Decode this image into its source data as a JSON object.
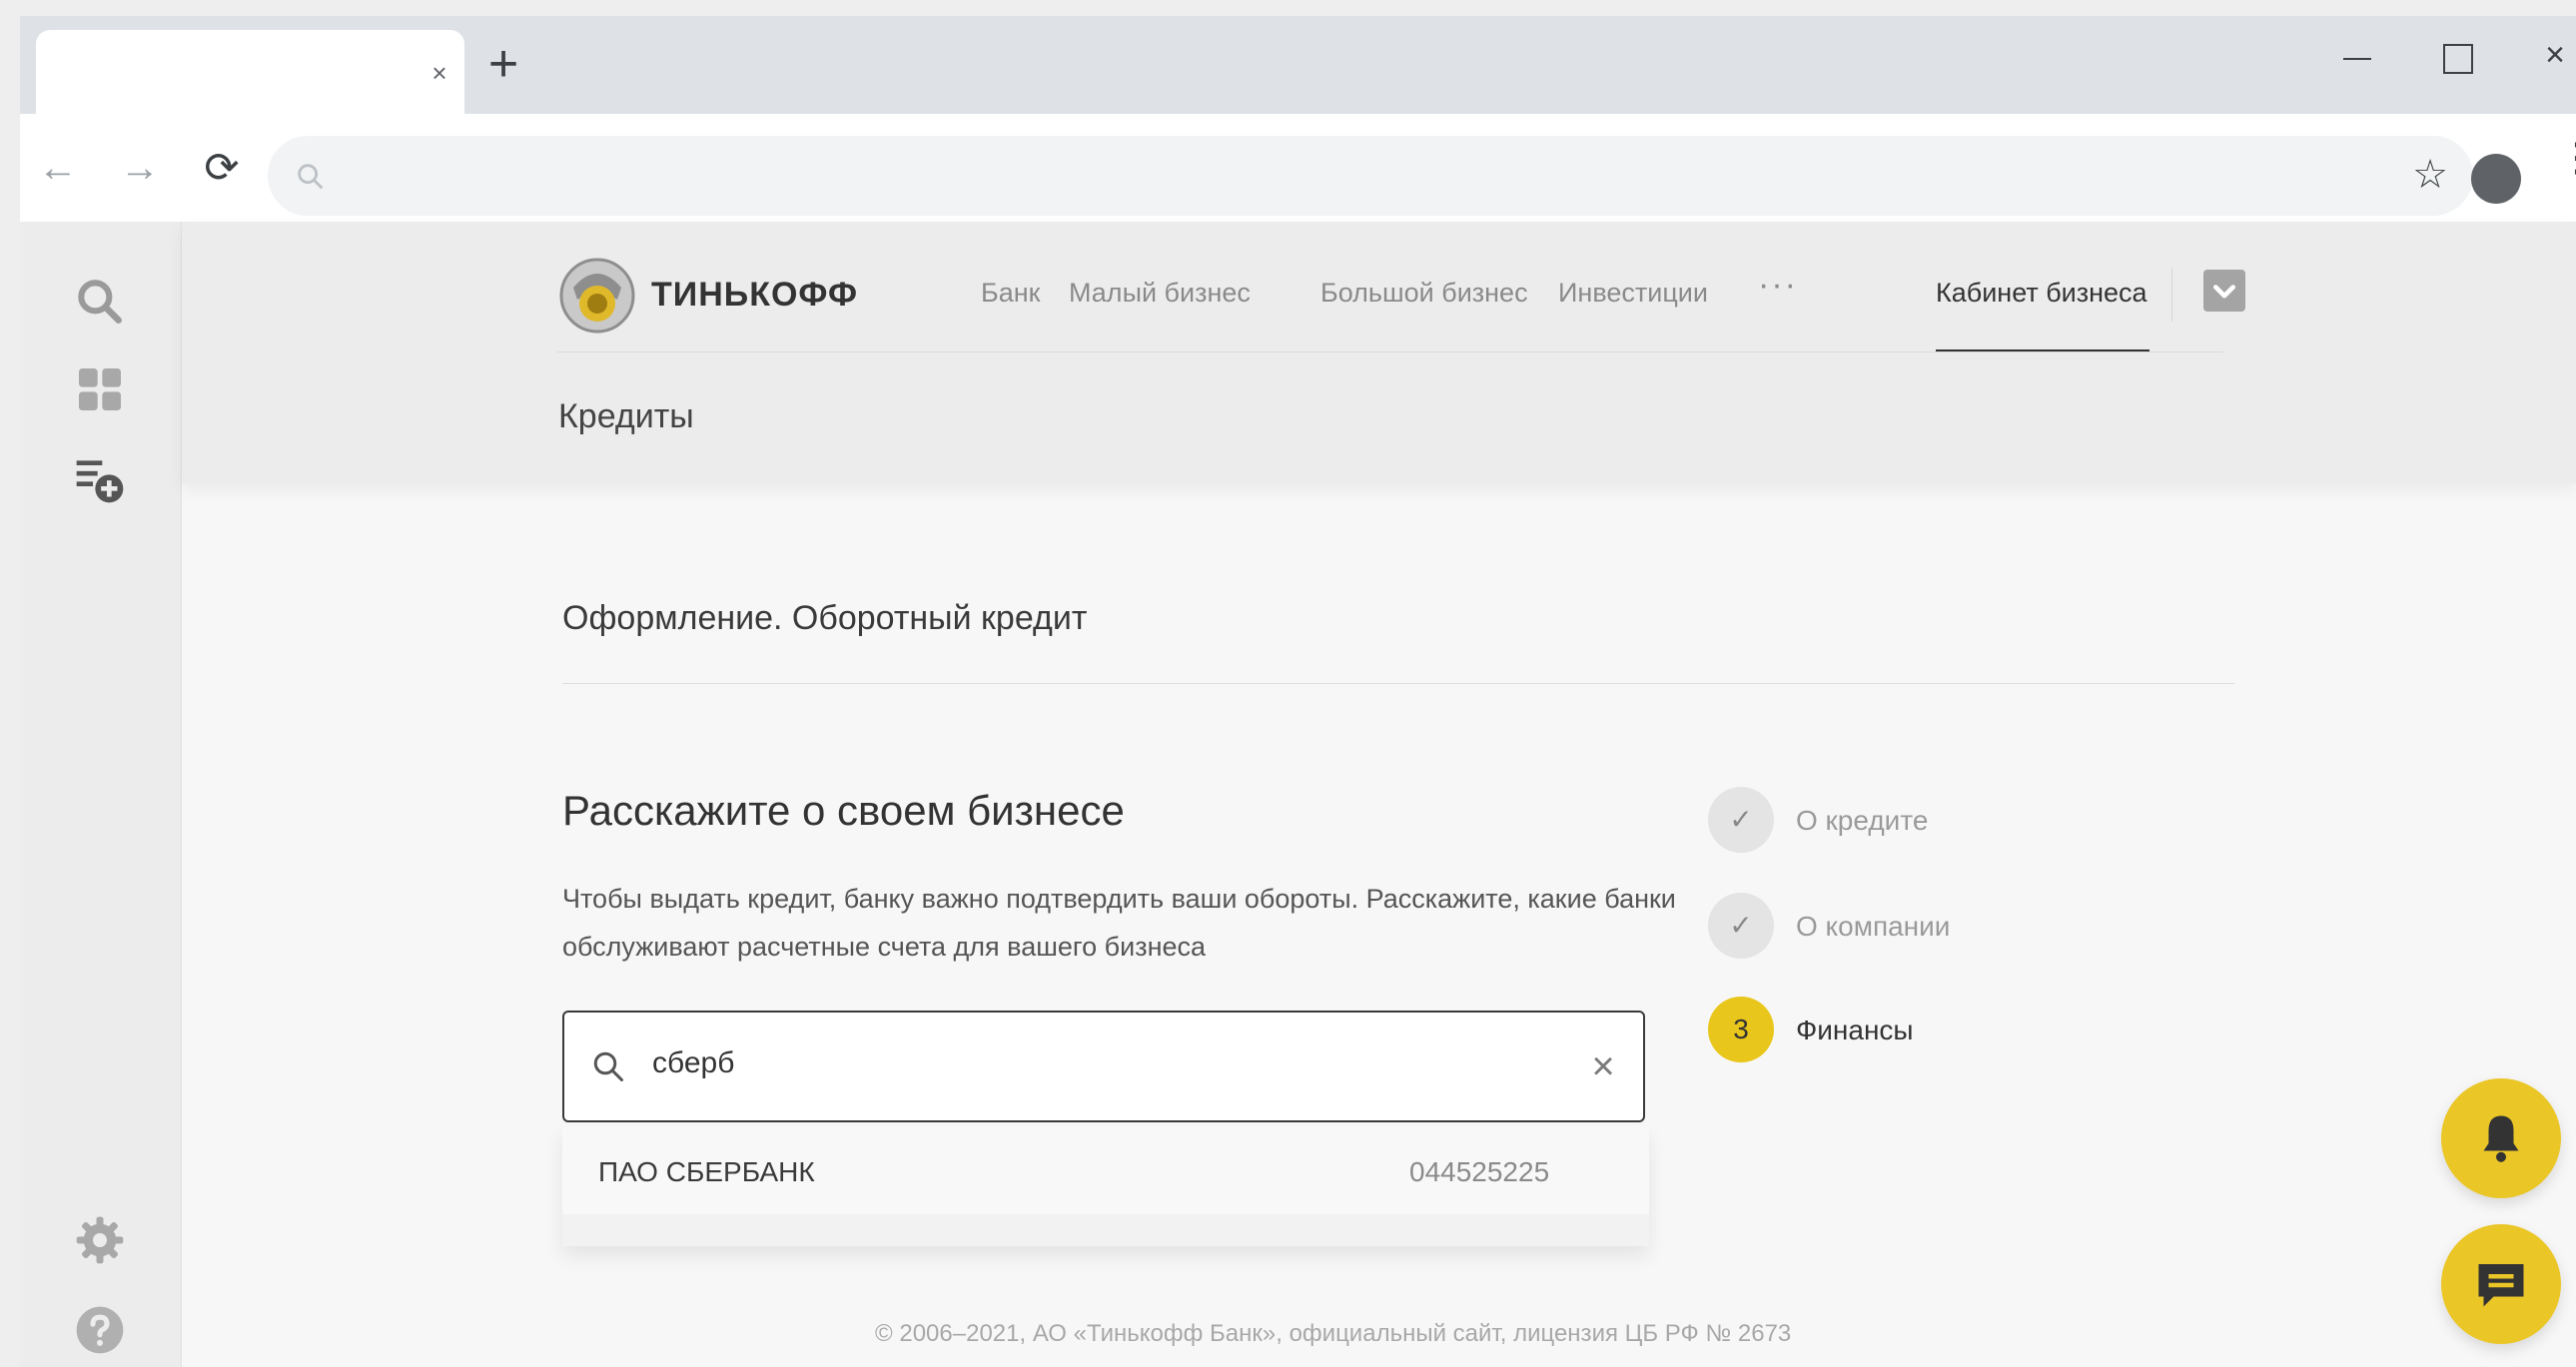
{
  "browser": {
    "tab_close_icon": "×",
    "new_tab_icon": "+",
    "window": {
      "minimize": "minimize-icon",
      "maximize": "maximize-icon",
      "close": "×"
    },
    "nav": {
      "back": "←",
      "forward": "→",
      "reload": "⟳"
    },
    "bookmark_icon": "☆",
    "menu_icon": "⋮"
  },
  "header": {
    "brand": "ТИНЬКОФФ",
    "nav": {
      "bank": "Банк",
      "small_business": "Малый бизнес",
      "large_business": "Большой бизнес",
      "investments": "Инвестиции",
      "more": "···",
      "cabinet": "Кабинет бизнеса"
    },
    "section_title": "Кредиты"
  },
  "main": {
    "form_title": "Оформление. Оборотный кредит",
    "heading": "Расскажите о своем бизнесе",
    "description": "Чтобы выдать кредит, банку важно подтвердить ваши обороты. Расскажите, какие банки обслуживают расчетные счета для вашего бизнеса",
    "search": {
      "value": "сберб",
      "clear_icon": "×"
    },
    "suggestions": [
      {
        "name": "ПАО СБЕРБАНК",
        "bik": "044525225"
      }
    ]
  },
  "stepper": [
    {
      "marker": "✓",
      "label": "О кредите",
      "state": "done"
    },
    {
      "marker": "✓",
      "label": "О компании",
      "state": "done"
    },
    {
      "marker": "3",
      "label": "Финансы",
      "state": "current"
    }
  ],
  "footer": "© 2006–2021, АО «Тинькофф Банк», официальный сайт, лицензия ЦБ РФ № 2673",
  "colors": {
    "accent": "#e9c61b",
    "fab": "#ebc627",
    "text": "#333333"
  }
}
